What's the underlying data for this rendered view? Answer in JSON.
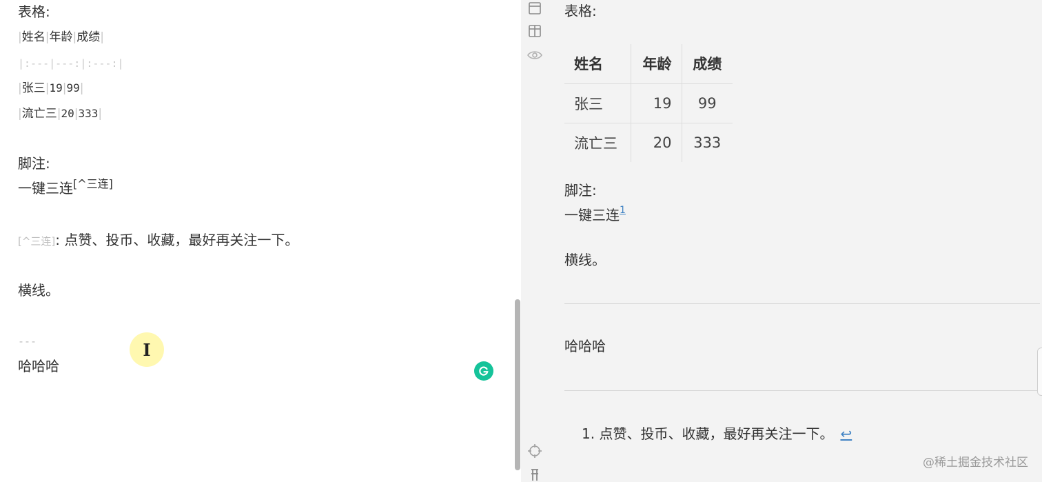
{
  "editor": {
    "table_heading": "表格:",
    "table_rows": [
      {
        "cells": [
          "姓名",
          "年龄",
          "成绩"
        ]
      },
      {
        "raw": "|:---|---:|:---:|"
      },
      {
        "cells": [
          "张三",
          "19",
          "99"
        ]
      },
      {
        "cells": [
          "流亡三",
          "20",
          "333"
        ]
      }
    ],
    "footnote_heading": "脚注:",
    "footnote_text": "一键三连",
    "footnote_ref": "[^三连]",
    "footnote_def_label": "[^三连]",
    "footnote_def_text": ": 点赞、投币、收藏，最好再关注一下。",
    "hr_heading": "横线。",
    "hr_markup": "---",
    "after_hr_text": "哈哈哈",
    "cursor_glyph": "I"
  },
  "preview": {
    "table_heading": "表格:",
    "table": {
      "headers": [
        "姓名",
        "年龄",
        "成绩"
      ],
      "rows": [
        [
          "张三",
          "19",
          "99"
        ],
        [
          "流亡三",
          "20",
          "333"
        ]
      ]
    },
    "footnote_heading": "脚注:",
    "footnote_text": "一键三连",
    "footnote_sup": "1",
    "hr_heading": "横线。",
    "after_hr_text": "哈哈哈",
    "footnote_entry": "1. 点赞、投币、收藏，最好再关注一下。",
    "footnote_backref": "↩"
  },
  "watermark": "@稀土掘金技术社区",
  "colors": {
    "link": "#4183c4",
    "grammarly": "#15c39a",
    "cursor_highlight": "#fff696"
  },
  "icons": [
    "layout-single-icon",
    "layout-split-icon",
    "preview-eye-icon",
    "crosshair-icon",
    "outline-icon",
    "grammarly-icon"
  ]
}
